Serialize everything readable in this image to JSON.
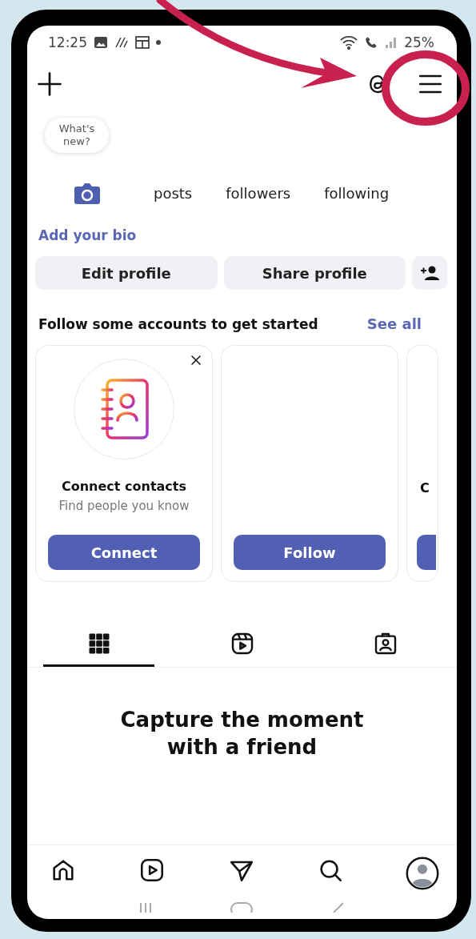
{
  "status_bar": {
    "time": "12:25",
    "battery": "25%"
  },
  "bubble": {
    "text": "What's new?"
  },
  "stats": [
    {
      "label": "posts"
    },
    {
      "label": "followers"
    },
    {
      "label": "following"
    }
  ],
  "bio_link": "Add your bio",
  "profile_buttons": [
    "Edit profile",
    "Share profile"
  ],
  "suggestions": {
    "title": "Follow some accounts to get started",
    "see_all": "See all",
    "cards": [
      {
        "kind": "contacts",
        "title": "Connect contacts",
        "subtitle": "Find people you know",
        "action": "Connect"
      },
      {
        "kind": "blank",
        "action": "Follow"
      },
      {
        "kind": "partial",
        "title": "C"
      }
    ]
  },
  "content_tabs": [
    {
      "kind": "grid",
      "selected": true
    },
    {
      "kind": "reels",
      "selected": false
    },
    {
      "kind": "tagged",
      "selected": false
    }
  ],
  "empty_state": {
    "title": "Capture the moment with a friend"
  },
  "bottom_nav": [
    {
      "kind": "home"
    },
    {
      "kind": "reels"
    },
    {
      "kind": "send"
    },
    {
      "kind": "search"
    },
    {
      "kind": "profile"
    }
  ]
}
